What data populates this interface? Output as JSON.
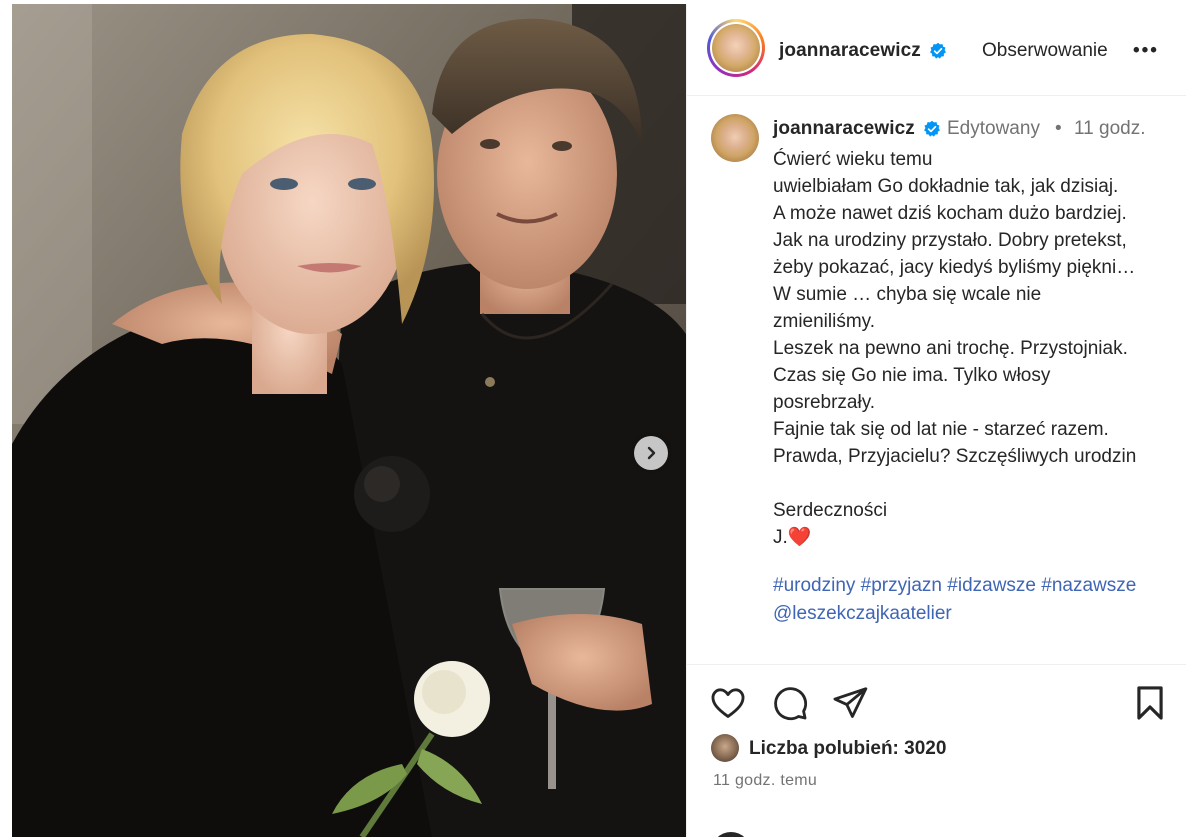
{
  "post": {
    "username": "joannaracewicz",
    "follow_label": "Obserwowanie",
    "more_label": "•••",
    "edited_label": "Edytowany",
    "dot": "•",
    "time_short": "11 godz.",
    "caption_lines": [
      "Ćwierć wieku temu",
      "uwielbiałam Go dokładnie tak, jak dzisiaj.",
      "A może nawet dziś kocham dużo bardziej.",
      "Jak na urodziny przystało. Dobry pretekst,",
      "żeby pokazać, jacy kiedyś byliśmy piękni…",
      "W sumie … chyba się wcale nie",
      "zmieniliśmy.",
      "Leszek na pewno ani trochę. Przystojniak.",
      "Czas się Go nie ima. Tylko włosy",
      "posrebrzały.",
      "Fajnie tak się od lat nie - starzeć razem.",
      "Prawda, Przyjacielu? Szczęśliwych urodzin",
      "",
      "Serdeczności",
      "J."
    ],
    "heart_emoji": "❤️",
    "hashtags": [
      "#urodziny",
      "#przyjazn",
      "#idzawsze",
      "#nazawsze"
    ],
    "mention": "@leszekczajkaatelier",
    "likes_text": "Liczba polubień: 3020",
    "time_long": "11 godz. temu"
  },
  "icons": {
    "verified": "verified-badge-icon",
    "next": "chevron-right-icon",
    "like": "heart-icon",
    "comment": "comment-icon",
    "share": "send-icon",
    "save": "bookmark-icon"
  },
  "colors": {
    "verified_blue": "#0095f6",
    "hashtag": "#3f65b5",
    "muted": "#737373",
    "text": "#262626"
  }
}
